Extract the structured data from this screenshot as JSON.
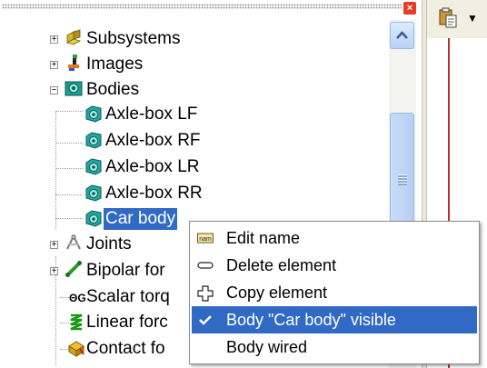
{
  "tree": {
    "items": [
      {
        "label": "Subsystems",
        "icon": "subsystems-icon"
      },
      {
        "label": "Images",
        "icon": "images-icon"
      },
      {
        "label": "Bodies",
        "icon": "bodies-icon"
      },
      {
        "label": "Axle-box LF",
        "icon": "body-icon"
      },
      {
        "label": "Axle-box RF",
        "icon": "body-icon"
      },
      {
        "label": "Axle-box LR",
        "icon": "body-icon"
      },
      {
        "label": "Axle-box RR",
        "icon": "body-icon"
      },
      {
        "label": "Car body",
        "icon": "body-icon",
        "selected": true
      },
      {
        "label": "Joints",
        "icon": "joints-icon"
      },
      {
        "label": "Bipolar for",
        "icon": "bipolar-force-icon"
      },
      {
        "label": "Scalar torq",
        "icon": "scalar-torque-icon"
      },
      {
        "label": "Linear forc",
        "icon": "linear-force-icon"
      },
      {
        "label": "Contact fo",
        "icon": "contact-force-icon"
      }
    ]
  },
  "context_menu": {
    "items": [
      {
        "label": "Edit name",
        "icon": "nam-icon"
      },
      {
        "label": "Delete element",
        "icon": "minus-icon"
      },
      {
        "label": "Copy element",
        "icon": "copy-plus-icon"
      },
      {
        "label": "Body \"Car body\" visible",
        "icon": "check-icon",
        "highlighted": true
      },
      {
        "label": "Body wired",
        "icon": ""
      }
    ]
  },
  "toolbar": {
    "paste_icon": "paste-icon",
    "dropdown_icon": "chevron-down-icon"
  },
  "colors": {
    "selection": "#316ac5",
    "body_icon": "#18a8a0",
    "accent_red": "#b83028"
  }
}
